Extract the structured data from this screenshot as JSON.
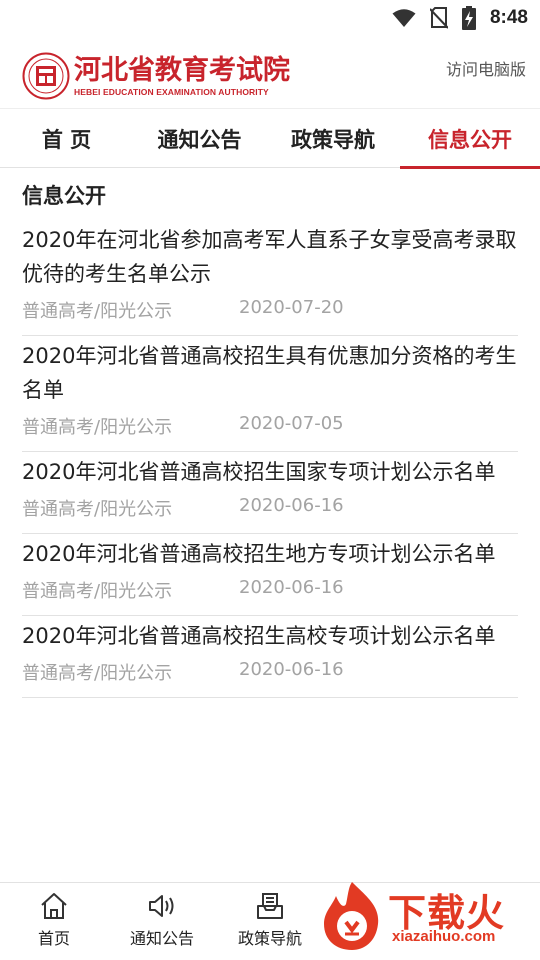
{
  "status_bar": {
    "time": "8:48",
    "icons": [
      "wifi-icon",
      "no-sim-icon",
      "battery-charging-icon"
    ]
  },
  "header": {
    "logo_cn": "河北省教育考试院",
    "logo_en": "HEBEI EDUCATION EXAMINATION AUTHORITY",
    "pc_link": "访问电脑版"
  },
  "tabs": [
    {
      "label": "首 页"
    },
    {
      "label": "通知公告"
    },
    {
      "label": "政策导航"
    },
    {
      "label": "信息公开"
    }
  ],
  "active_tab": "信息公开",
  "section": {
    "title": "信息公开"
  },
  "news": [
    {
      "title": "2020年在河北省参加高考军人直系子女享受高考录取优待的考生名单公示",
      "category": "普通高考/阳光公示",
      "date": "2020-07-20"
    },
    {
      "title": "2020年河北省普通高校招生具有优惠加分资格的考生名单",
      "category": "普通高考/阳光公示",
      "date": "2020-07-05"
    },
    {
      "title": "2020年河北省普通高校招生国家专项计划公示名单",
      "category": "普通高考/阳光公示",
      "date": "2020-06-16"
    },
    {
      "title": "2020年河北省普通高校招生地方专项计划公示名单",
      "category": "普通高考/阳光公示",
      "date": "2020-06-16"
    },
    {
      "title": "2020年河北省普通高校招生高校专项计划公示名单",
      "category": "普通高考/阳光公示",
      "date": "2020-06-16"
    }
  ],
  "bottom_nav": [
    {
      "label": "首页",
      "icon": "home-icon"
    },
    {
      "label": "通知公告",
      "icon": "speaker-icon"
    },
    {
      "label": "政策导航",
      "icon": "inbox-icon"
    }
  ],
  "watermark": {
    "text": "下载火",
    "url": "xiazaihuo.com"
  },
  "colors": {
    "brand": "#c8242c",
    "meta": "#a3a3a3",
    "divider": "#e2e2e2"
  }
}
